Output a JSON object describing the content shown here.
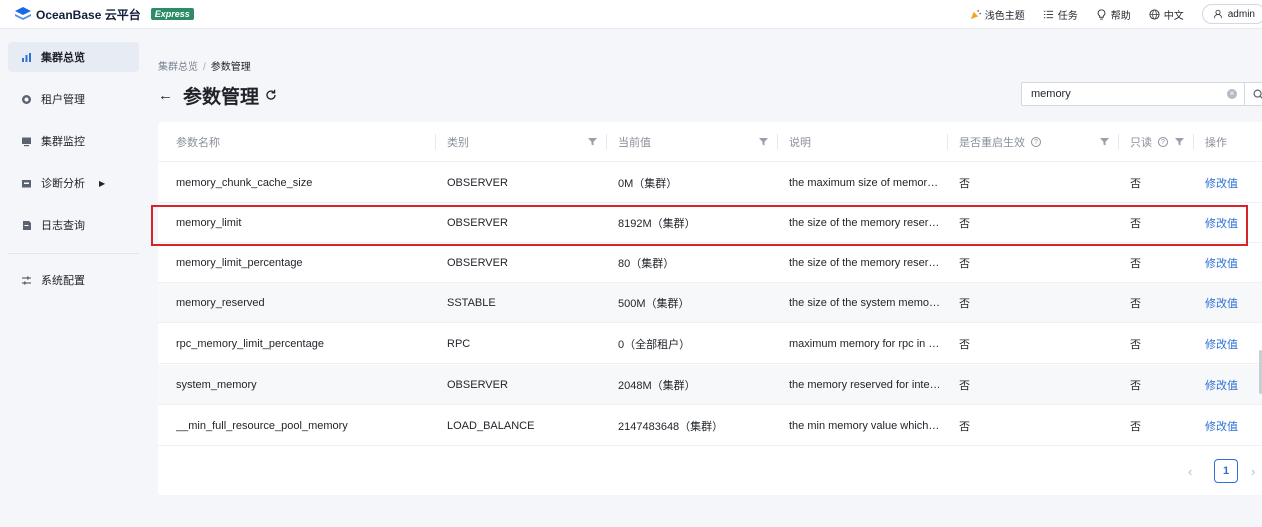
{
  "app": {
    "logo_text": "OceanBase 云平台",
    "badge": "Express"
  },
  "topnav": {
    "theme": "浅色主题",
    "tasks": "任务",
    "help": "帮助",
    "lang": "中文",
    "user": "admin"
  },
  "sidebar": {
    "items": [
      {
        "label": "集群总览",
        "icon": "bar-chart-icon"
      },
      {
        "label": "租户管理",
        "icon": "tenant-icon"
      },
      {
        "label": "集群监控",
        "icon": "monitor-icon"
      },
      {
        "label": "诊断分析",
        "icon": "diagnose-icon"
      },
      {
        "label": "日志查询",
        "icon": "log-icon"
      },
      {
        "label": "系统配置",
        "icon": "sliders-icon"
      }
    ]
  },
  "breadcrumb": {
    "parent": "集群总览",
    "separator": "/",
    "current": "参数管理"
  },
  "page": {
    "title": "参数管理",
    "back_arrow": "←"
  },
  "search": {
    "value": "memory"
  },
  "table": {
    "columns": [
      "参数名称",
      "类别",
      "当前值",
      "说明",
      "是否重启生效",
      "只读",
      "操作"
    ],
    "rows": [
      {
        "name": "memory_chunk_cache_size",
        "category": "OBSERVER",
        "value": "0M（集群）",
        "desc": "the maximum size of memor…",
        "restart": "否",
        "readonly": "否",
        "action": "修改值"
      },
      {
        "name": "memory_limit",
        "category": "OBSERVER",
        "value": "8192M（集群）",
        "desc": "the size of the memory reser…",
        "restart": "否",
        "readonly": "否",
        "action": "修改值"
      },
      {
        "name": "memory_limit_percentage",
        "category": "OBSERVER",
        "value": "80（集群）",
        "desc": "the size of the memory reser…",
        "restart": "否",
        "readonly": "否",
        "action": "修改值"
      },
      {
        "name": "memory_reserved",
        "category": "SSTABLE",
        "value": "500M（集群）",
        "desc": "the size of the system memo…",
        "restart": "否",
        "readonly": "否",
        "action": "修改值"
      },
      {
        "name": "rpc_memory_limit_percentage",
        "category": "RPC",
        "value": "0（全部租户）",
        "desc": "maximum memory for rpc in …",
        "restart": "否",
        "readonly": "否",
        "action": "修改值"
      },
      {
        "name": "system_memory",
        "category": "OBSERVER",
        "value": "2048M（集群）",
        "desc": "the memory reserved for inte…",
        "restart": "否",
        "readonly": "否",
        "action": "修改值"
      },
      {
        "name": "__min_full_resource_pool_memory",
        "category": "LOAD_BALANCE",
        "value": "2147483648（集群）",
        "desc": "the min memory value which…",
        "restart": "否",
        "readonly": "否",
        "action": "修改值"
      }
    ]
  },
  "pagination": {
    "prev": "‹",
    "current": "1",
    "next": "›"
  },
  "colors": {
    "accent": "#2f6fd6",
    "highlight": "#d8232a",
    "badge": "#2d8c67"
  }
}
